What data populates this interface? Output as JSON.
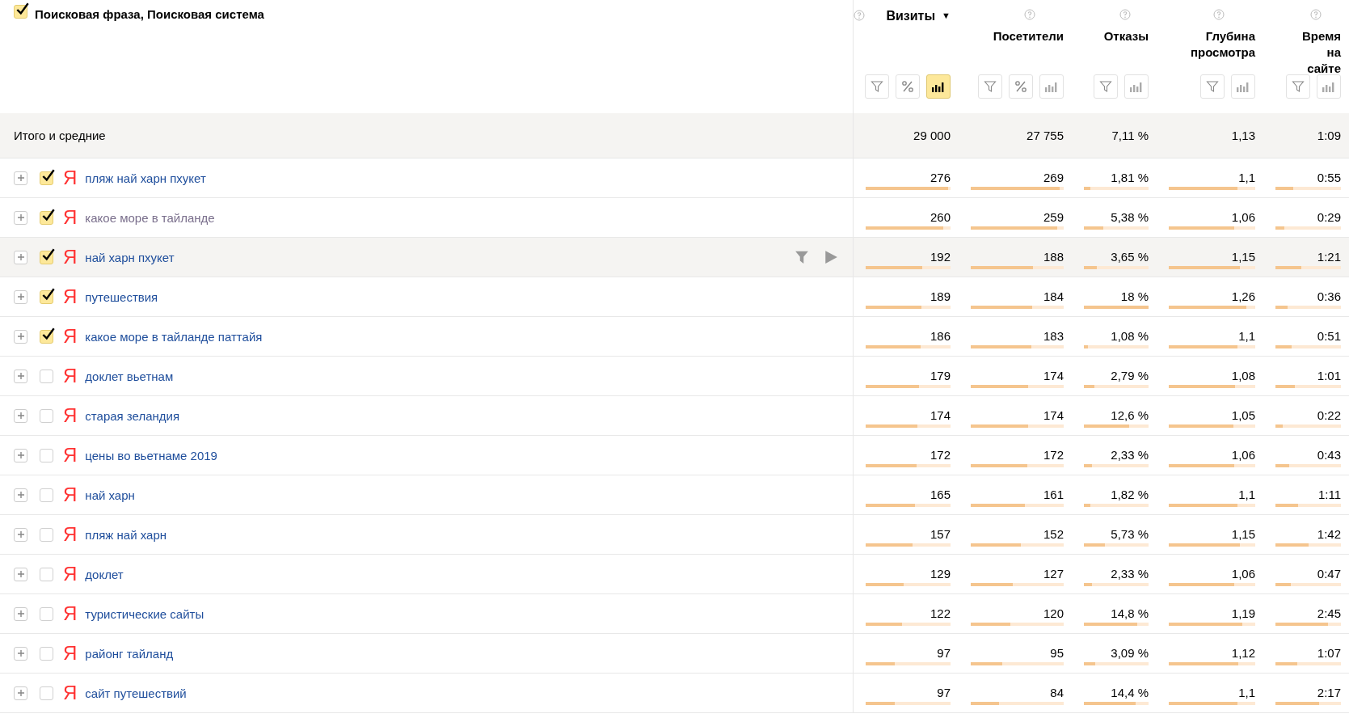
{
  "dimension_header": {
    "label": "Поисковая фраза, Поисковая система",
    "checked": true
  },
  "columns": [
    {
      "title": "Визиты",
      "sorted": true,
      "sort_mark": "▼",
      "buttons": [
        {
          "kind": "filter",
          "selected": false
        },
        {
          "kind": "percent",
          "selected": false
        },
        {
          "kind": "bars",
          "selected": true
        }
      ]
    },
    {
      "title": "Посетители",
      "sorted": false,
      "buttons": [
        {
          "kind": "filter",
          "selected": false
        },
        {
          "kind": "percent",
          "selected": false
        },
        {
          "kind": "bars",
          "selected": false
        }
      ]
    },
    {
      "title": "Отказы",
      "sorted": false,
      "buttons": [
        {
          "kind": "filter",
          "selected": false
        },
        {
          "kind": "bars",
          "selected": false
        }
      ]
    },
    {
      "title": "Глубина просмотра",
      "sorted": false,
      "buttons": [
        {
          "kind": "filter",
          "selected": false
        },
        {
          "kind": "bars",
          "selected": false
        }
      ]
    },
    {
      "title": "Время на сайте",
      "sorted": false,
      "buttons": [
        {
          "kind": "filter",
          "selected": false
        },
        {
          "kind": "bars",
          "selected": false
        }
      ]
    }
  ],
  "totals": {
    "label": "Итого и средние",
    "values": [
      "29 000",
      "27 755",
      "7,11 %",
      "1,13",
      "1:09"
    ]
  },
  "rows": [
    {
      "phrase": "пляж най харн пхукет",
      "engine": "Я",
      "checked": true,
      "visited": false,
      "hovered": false,
      "cells": [
        {
          "value": "276",
          "level": 0.97
        },
        {
          "value": "269",
          "level": 0.96
        },
        {
          "value": "1,81 %",
          "level": 0.1
        },
        {
          "value": "1,1",
          "level": 0.79
        },
        {
          "value": "0:55",
          "level": 0.27
        }
      ]
    },
    {
      "phrase": "какое море в тайланде",
      "engine": "Я",
      "checked": true,
      "visited": true,
      "hovered": false,
      "cells": [
        {
          "value": "260",
          "level": 0.91
        },
        {
          "value": "259",
          "level": 0.93
        },
        {
          "value": "5,38 %",
          "level": 0.3
        },
        {
          "value": "1,06",
          "level": 0.76
        },
        {
          "value": "0:29",
          "level": 0.14
        }
      ]
    },
    {
      "phrase": "най харн пхукет",
      "engine": "Я",
      "checked": true,
      "visited": false,
      "hovered": true,
      "cells": [
        {
          "value": "192",
          "level": 0.67
        },
        {
          "value": "188",
          "level": 0.67
        },
        {
          "value": "3,65 %",
          "level": 0.2
        },
        {
          "value": "1,15",
          "level": 0.82
        },
        {
          "value": "1:21",
          "level": 0.4
        }
      ]
    },
    {
      "phrase": "путешествия",
      "engine": "Я",
      "checked": true,
      "visited": false,
      "hovered": false,
      "cells": [
        {
          "value": "189",
          "level": 0.66
        },
        {
          "value": "184",
          "level": 0.66
        },
        {
          "value": "18 %",
          "level": 1
        },
        {
          "value": "1,26",
          "level": 0.9
        },
        {
          "value": "0:36",
          "level": 0.18
        }
      ]
    },
    {
      "phrase": "какое море в тайланде паттайя",
      "engine": "Я",
      "checked": true,
      "visited": false,
      "hovered": false,
      "cells": [
        {
          "value": "186",
          "level": 0.65
        },
        {
          "value": "183",
          "level": 0.65
        },
        {
          "value": "1,08 %",
          "level": 0.06
        },
        {
          "value": "1,1",
          "level": 0.79
        },
        {
          "value": "0:51",
          "level": 0.25
        }
      ]
    },
    {
      "phrase": "доклет вьетнам",
      "engine": "Я",
      "checked": false,
      "visited": false,
      "hovered": false,
      "cells": [
        {
          "value": "179",
          "level": 0.63
        },
        {
          "value": "174",
          "level": 0.62
        },
        {
          "value": "2,79 %",
          "level": 0.16
        },
        {
          "value": "1,08",
          "level": 0.77
        },
        {
          "value": "1:01",
          "level": 0.3
        }
      ]
    },
    {
      "phrase": "старая зеландия",
      "engine": "Я",
      "checked": false,
      "visited": false,
      "hovered": false,
      "cells": [
        {
          "value": "174",
          "level": 0.61
        },
        {
          "value": "174",
          "level": 0.62
        },
        {
          "value": "12,6 %",
          "level": 0.7
        },
        {
          "value": "1,05",
          "level": 0.75
        },
        {
          "value": "0:22",
          "level": 0.11
        }
      ]
    },
    {
      "phrase": "цены во вьетнаме 2019",
      "engine": "Я",
      "checked": false,
      "visited": false,
      "hovered": false,
      "cells": [
        {
          "value": "172",
          "level": 0.6
        },
        {
          "value": "172",
          "level": 0.61
        },
        {
          "value": "2,33 %",
          "level": 0.13
        },
        {
          "value": "1,06",
          "level": 0.76
        },
        {
          "value": "0:43",
          "level": 0.21
        }
      ]
    },
    {
      "phrase": "най харн",
      "engine": "Я",
      "checked": false,
      "visited": false,
      "hovered": false,
      "cells": [
        {
          "value": "165",
          "level": 0.58
        },
        {
          "value": "161",
          "level": 0.58
        },
        {
          "value": "1,82 %",
          "level": 0.1
        },
        {
          "value": "1,1",
          "level": 0.79
        },
        {
          "value": "1:11",
          "level": 0.35
        }
      ]
    },
    {
      "phrase": "пляж най харн",
      "engine": "Я",
      "checked": false,
      "visited": false,
      "hovered": false,
      "cells": [
        {
          "value": "157",
          "level": 0.55
        },
        {
          "value": "152",
          "level": 0.54
        },
        {
          "value": "5,73 %",
          "level": 0.32
        },
        {
          "value": "1,15",
          "level": 0.82
        },
        {
          "value": "1:42",
          "level": 0.5
        }
      ]
    },
    {
      "phrase": "доклет",
      "engine": "Я",
      "checked": false,
      "visited": false,
      "hovered": false,
      "cells": [
        {
          "value": "129",
          "level": 0.45
        },
        {
          "value": "127",
          "level": 0.45
        },
        {
          "value": "2,33 %",
          "level": 0.13
        },
        {
          "value": "1,06",
          "level": 0.76
        },
        {
          "value": "0:47",
          "level": 0.23
        }
      ]
    },
    {
      "phrase": "туристические сайты",
      "engine": "Я",
      "checked": false,
      "visited": false,
      "hovered": false,
      "cells": [
        {
          "value": "122",
          "level": 0.43
        },
        {
          "value": "120",
          "level": 0.43
        },
        {
          "value": "14,8 %",
          "level": 0.82
        },
        {
          "value": "1,19",
          "level": 0.85
        },
        {
          "value": "2:45",
          "level": 0.8
        }
      ]
    },
    {
      "phrase": "районг тайланд",
      "engine": "Я",
      "checked": false,
      "visited": false,
      "hovered": false,
      "cells": [
        {
          "value": "97",
          "level": 0.34
        },
        {
          "value": "95",
          "level": 0.34
        },
        {
          "value": "3,09 %",
          "level": 0.17
        },
        {
          "value": "1,12",
          "level": 0.8
        },
        {
          "value": "1:07",
          "level": 0.33
        }
      ]
    },
    {
      "phrase": "сайт путешествий",
      "engine": "Я",
      "checked": false,
      "visited": false,
      "hovered": false,
      "cells": [
        {
          "value": "97",
          "level": 0.34
        },
        {
          "value": "84",
          "level": 0.3
        },
        {
          "value": "14,4 %",
          "level": 0.8
        },
        {
          "value": "1,1",
          "level": 0.79
        },
        {
          "value": "2:17",
          "level": 0.67
        }
      ]
    }
  ]
}
